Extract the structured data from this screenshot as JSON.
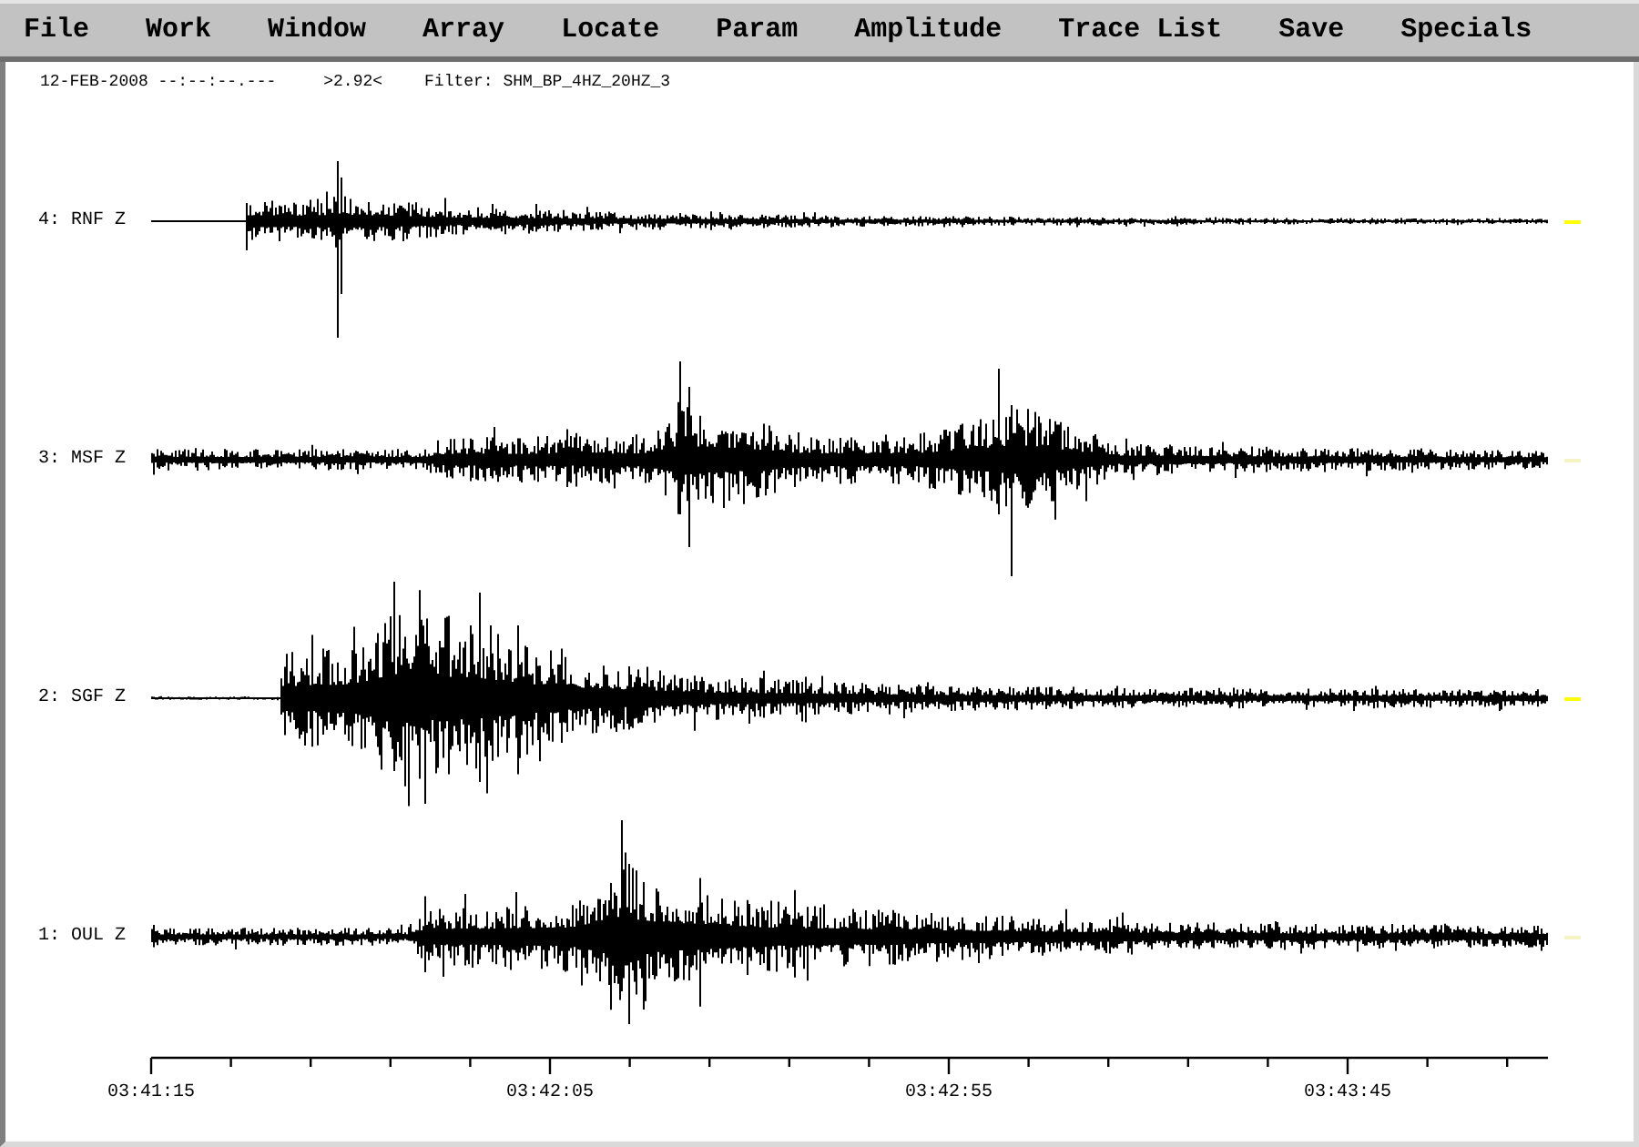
{
  "menu": {
    "items": [
      "File",
      "Work",
      "Window",
      "Array",
      "Locate",
      "Param",
      "Amplitude",
      "Trace List",
      "Save",
      "Specials"
    ]
  },
  "header": {
    "datetime": "12-FEB-2008 --:--:--.---",
    "amplitude": ">2.92<",
    "filter": "Filter: SHM_BP_4HZ_20HZ_3"
  },
  "traces": [
    {
      "label": "4: RNF Z",
      "color": "#ffff00"
    },
    {
      "label": "3: MSF Z",
      "color": "#f4f4c4"
    },
    {
      "label": "2: SGF Z",
      "color": "#ffff00"
    },
    {
      "label": "1: OUL Z",
      "color": "#f4f4c4"
    }
  ],
  "time_axis": {
    "labels": [
      "03:41:15",
      "03:42:05",
      "03:42:55",
      "03:43:45"
    ]
  }
}
